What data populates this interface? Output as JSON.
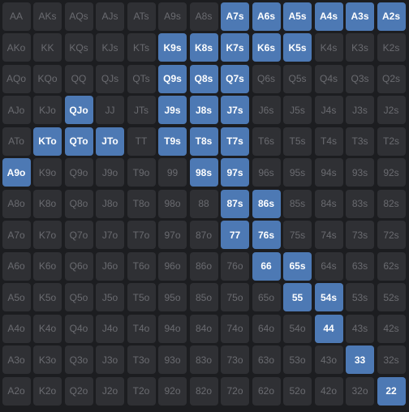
{
  "grid": {
    "hands": [
      [
        "AA",
        "AKs",
        "AQs",
        "AJs",
        "ATs",
        "A9s",
        "A8s",
        "A7s",
        "A6s",
        "A5s",
        "A4s",
        "A3s",
        "A2s"
      ],
      [
        "AKo",
        "KK",
        "KQs",
        "KJs",
        "KTs",
        "K9s",
        "K8s",
        "K7s",
        "K6s",
        "K5s",
        "K4s",
        "K3s",
        "K2s"
      ],
      [
        "AQo",
        "KQo",
        "QQ",
        "QJs",
        "QTs",
        "Q9s",
        "Q8s",
        "Q7s",
        "Q6s",
        "Q5s",
        "Q4s",
        "Q3s",
        "Q2s"
      ],
      [
        "AJo",
        "KJo",
        "QJo",
        "JJ",
        "JTs",
        "J9s",
        "J8s",
        "J7s",
        "J6s",
        "J5s",
        "J4s",
        "J3s",
        "J2s"
      ],
      [
        "ATo",
        "KTo",
        "QTo",
        "JTo",
        "TT",
        "T9s",
        "T8s",
        "T7s",
        "T6s",
        "T5s",
        "T4s",
        "T3s",
        "T2s"
      ],
      [
        "A9o",
        "K9o",
        "Q9o",
        "J9o",
        "T9o",
        "99",
        "98s",
        "97s",
        "96s",
        "95s",
        "94s",
        "93s",
        "92s"
      ],
      [
        "A8o",
        "K8o",
        "Q8o",
        "J8o",
        "T8o",
        "98o",
        "88",
        "87s",
        "86s",
        "85s",
        "84s",
        "83s",
        "82s"
      ],
      [
        "A7o",
        "K7o",
        "Q7o",
        "J7o",
        "T7o",
        "97o",
        "87o",
        "77",
        "76s",
        "75s",
        "74s",
        "73s",
        "72s"
      ],
      [
        "A6o",
        "K6o",
        "Q6o",
        "J6o",
        "T6o",
        "96o",
        "86o",
        "76o",
        "66",
        "65s",
        "64s",
        "63s",
        "62s"
      ],
      [
        "A5o",
        "K5o",
        "Q5o",
        "J5o",
        "T5o",
        "95o",
        "85o",
        "75o",
        "65o",
        "55",
        "54s",
        "53s",
        "52s"
      ],
      [
        "A4o",
        "K4o",
        "Q4o",
        "J4o",
        "T4o",
        "94o",
        "84o",
        "74o",
        "64o",
        "54o",
        "44",
        "43s",
        "42s"
      ],
      [
        "A3o",
        "K3o",
        "Q3o",
        "J3o",
        "T3o",
        "93o",
        "83o",
        "73o",
        "63o",
        "53o",
        "43o",
        "33",
        "32s"
      ],
      [
        "A2o",
        "K2o",
        "Q2o",
        "J2o",
        "T2o",
        "92o",
        "82o",
        "72o",
        "62o",
        "52o",
        "42o",
        "32o",
        "22"
      ]
    ],
    "selected": [
      "A7s",
      "A6s",
      "A5s",
      "A4s",
      "A3s",
      "A2s",
      "K9s",
      "K8s",
      "K7s",
      "K6s",
      "K5s",
      "Q9s",
      "Q8s",
      "Q7s",
      "QJo",
      "J9s",
      "J8s",
      "J7s",
      "KTo",
      "QTo",
      "JTo",
      "T9s",
      "T8s",
      "T7s",
      "A9o",
      "98s",
      "97s",
      "87s",
      "86s",
      "77",
      "76s",
      "66",
      "65s",
      "55",
      "54s",
      "44",
      "33",
      "22"
    ],
    "colors": {
      "selected_bg": "#4d79b4",
      "unselected_bg": "#2f3034",
      "unselected_text": "#6a6b70",
      "page_bg": "#1c1d20"
    }
  }
}
